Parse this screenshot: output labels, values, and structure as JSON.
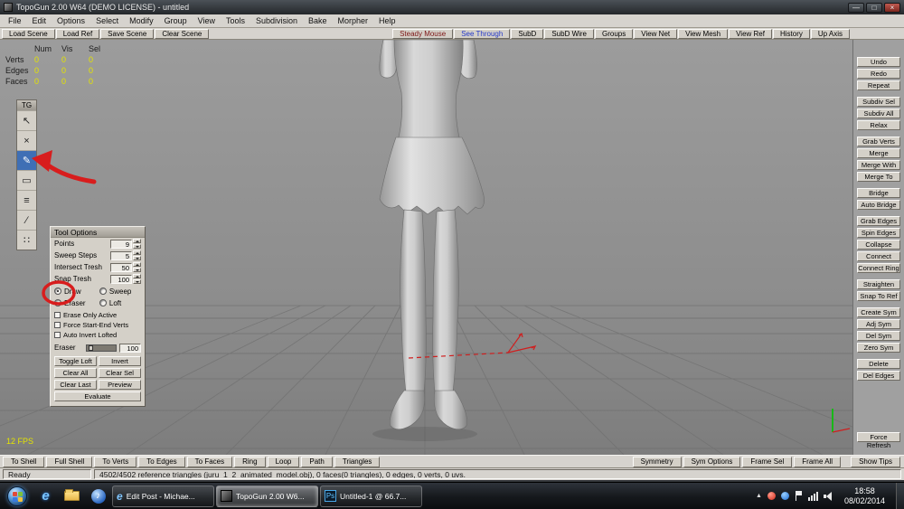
{
  "icons": {
    "minimize": "—",
    "maximize": "□",
    "close": "×",
    "tray_chevron": "▲",
    "ie": "e",
    "media": "♪"
  },
  "window": {
    "title": "TopoGun 2.00 W64  (DEMO LICENSE)  - untitled",
    "menus": [
      "File",
      "Edit",
      "Options",
      "Select",
      "Modify",
      "Group",
      "View",
      "Tools",
      "Subdivision",
      "Bake",
      "Morpher",
      "Help"
    ]
  },
  "toolbar": {
    "left": [
      "Load Scene",
      "Load Ref",
      "Save Scene",
      "Clear Scene"
    ],
    "right": [
      "Steady Mouse",
      "See Through",
      "SubD",
      "SubD Wire",
      "Groups",
      "View Net",
      "View Mesh",
      "View Ref",
      "History",
      "Up Axis"
    ]
  },
  "stats": {
    "headers": [
      "Num",
      "Vis",
      "Sel"
    ],
    "rows": [
      {
        "label": "Verts",
        "num": "0",
        "vis": "0",
        "sel": "0"
      },
      {
        "label": "Edges",
        "num": "0",
        "vis": "0",
        "sel": "0"
      },
      {
        "label": "Faces",
        "num": "0",
        "vis": "0",
        "sel": "0"
      }
    ]
  },
  "palette": {
    "title": "TG",
    "tools": [
      {
        "name": "select",
        "glyph": "↖"
      },
      {
        "name": "delete",
        "glyph": "×"
      },
      {
        "name": "draw",
        "glyph": "✎"
      },
      {
        "name": "bridge",
        "glyph": "▭"
      },
      {
        "name": "tweak",
        "glyph": "≡"
      },
      {
        "name": "simple-create",
        "glyph": "∕"
      },
      {
        "name": "brush",
        "glyph": "∷"
      }
    ],
    "active_tool": "draw"
  },
  "tool_options": {
    "title": "Tool Options",
    "spinners": [
      {
        "label": "Points",
        "value": "9"
      },
      {
        "label": "Sweep Steps",
        "value": "5"
      },
      {
        "label": "Intersect Tresh",
        "value": "50"
      },
      {
        "label": "Snap Tresh",
        "value": "100"
      }
    ],
    "radios": [
      {
        "label": "Draw",
        "selected": true
      },
      {
        "label": "Eraser",
        "selected": false
      },
      {
        "label": "Sweep",
        "selected": false
      },
      {
        "label": "Loft",
        "selected": false
      }
    ],
    "checkboxes": [
      "Erase Only Active",
      "Force Start-End Verts",
      "Auto Invert Lofted"
    ],
    "eraser": {
      "label": "Eraser",
      "value": "100"
    },
    "buttons": [
      "Toggle Loft",
      "Invert",
      "Clear All",
      "Clear Sel",
      "Clear Last",
      "Preview",
      "Evaluate"
    ]
  },
  "right_panel": {
    "groups": [
      [
        "Undo",
        "Redo",
        "Repeat"
      ],
      [
        "Subdiv Sel",
        "Subdiv All",
        "Relax"
      ],
      [
        "Grab Verts",
        "Merge",
        "Merge With",
        "Merge To"
      ],
      [
        "Bridge",
        "Auto Bridge"
      ],
      [
        "Grab Edges",
        "Spin Edges",
        "Collapse",
        "Connect",
        "Connect Ring"
      ],
      [
        "Straighten",
        "Snap To Ref"
      ],
      [
        "Create Sym",
        "Adj Sym",
        "Del Sym",
        "Zero Sym"
      ],
      [
        "Delete",
        "Del Edges"
      ]
    ],
    "force_refresh": "Force Refresh",
    "show_tips": "Show Tips"
  },
  "bottom_bar": {
    "left": [
      "To Shell",
      "Full Shell",
      "To Verts",
      "To Edges",
      "To Faces",
      "Ring",
      "Loop",
      "Path",
      "Triangles"
    ],
    "right": [
      "Symmetry",
      "Sym Options",
      "Frame Sel",
      "Frame All"
    ]
  },
  "status": {
    "state": "Ready",
    "info": "4502/4502 reference triangles (juru_1_2_animated_model.obj), 0 faces(0 triangles), 0 edges, 0 verts, 0 uvs."
  },
  "viewport": {
    "fps": "12 FPS"
  },
  "taskbar": {
    "tasks": [
      {
        "label": "Edit Post - Michae...",
        "active": false
      },
      {
        "label": "TopoGun 2.00 W6...",
        "active": true
      },
      {
        "label": "Untitled-1 @ 66.7...",
        "active": false
      }
    ],
    "ps_badge": "Ps",
    "clock": {
      "time": "18:58",
      "date": "08/02/2014"
    }
  },
  "colors": {
    "stats_value": "#e4e400",
    "fps_text": "#e4e400",
    "see_through_text": "#2438c8",
    "steady_mouse_text": "#7c1414",
    "annotation_red": "#d81d1d",
    "active_tool_bg": "#3f6fb5",
    "viewport_gray": "#8f8f8f"
  }
}
